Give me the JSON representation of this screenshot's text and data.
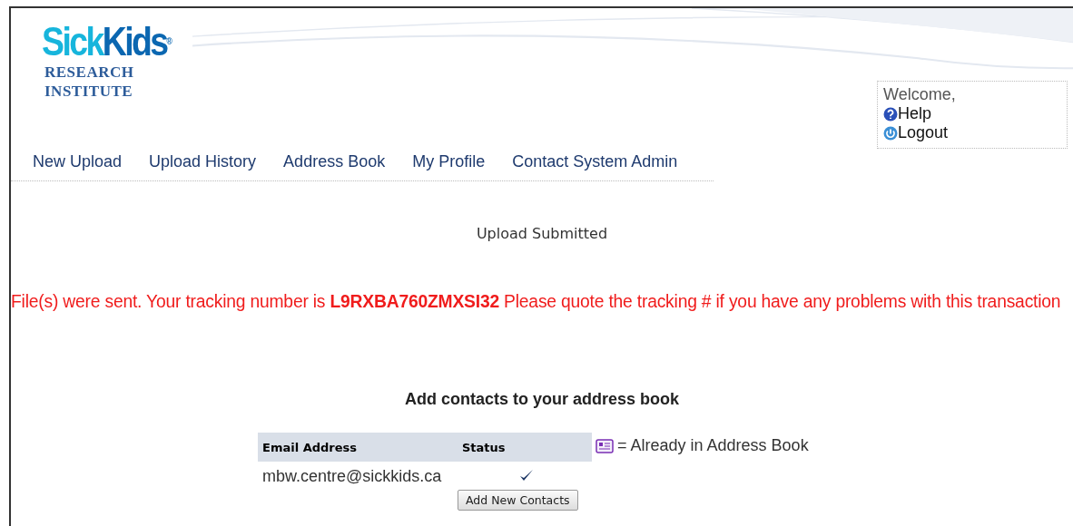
{
  "logo": {
    "brand_light": "Sick",
    "brand_dark": "Kids",
    "registered": "®",
    "line_1": "RESEARCH",
    "line_2": "INSTITUTE"
  },
  "user_box": {
    "welcome": "Welcome,",
    "links": [
      {
        "kind": "help",
        "label": "Help"
      },
      {
        "kind": "logout",
        "label": "Logout"
      }
    ]
  },
  "nav": [
    "New Upload",
    "Upload History",
    "Address Book",
    "My Profile",
    "Contact System Admin"
  ],
  "page_title": "Upload Submitted",
  "message": "File(s) were sent. Your tracking number is **L9RXBA760ZMXSI32** Please quote the tracking # if you have any problems with this transaction",
  "contacts": {
    "title": "Add contacts to your address book",
    "columns": [
      "Email Address",
      "Status"
    ],
    "rows": [
      {
        "email": "mbw.centre@sickkids.ca",
        "checked": true
      }
    ],
    "legend": "= Already in Address Book",
    "button": "Add New Contacts"
  }
}
